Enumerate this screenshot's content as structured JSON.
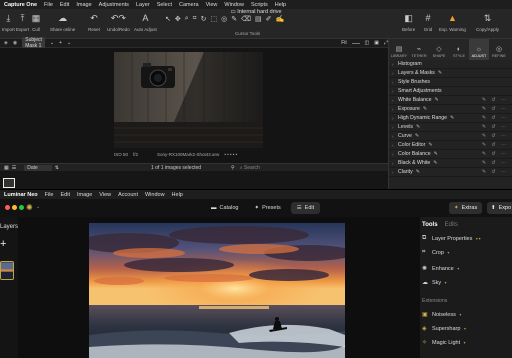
{
  "c1": {
    "menu": [
      "Capture One",
      "File",
      "Edit",
      "Image",
      "Adjustments",
      "Layer",
      "Select",
      "Camera",
      "View",
      "Window",
      "Scripts",
      "Help"
    ],
    "window_title": "Internal hard drive",
    "toolbar": {
      "import": "Import",
      "export": "Export",
      "cull": "Cull",
      "share": "Share online",
      "reset": "Reset",
      "undo_redo": "Undo/Redo",
      "auto_adjust": "Auto Adjust",
      "cursor_tools": "Cursor Tools",
      "before": "Before",
      "grid": "Grid",
      "exposure_warning": "Exp. Warning",
      "copy_apply": "Copy/Apply"
    },
    "subbar": {
      "subject_mask": "Subject Mask 1",
      "fit": "Fit"
    },
    "image_meta": {
      "iso": "ISO 50",
      "f": "f/2",
      "camera": "Sony-RX100Mark2-Shot43.arw",
      "rating": "• • • • •"
    },
    "bottombar": {
      "sort": "Date",
      "count": "1 of 1 images selected",
      "search_placeholder": "Search"
    },
    "tool_tabs": [
      "LIBRARY",
      "TETHER",
      "SHAPE",
      "STYLE",
      "ADJUST",
      "REFINE"
    ],
    "active_tab": "ADJUST",
    "panel_rows": [
      "Histogram",
      "Layers & Masks",
      "Style Brushes",
      "Smart Adjustments",
      "White Balance",
      "Exposure",
      "High Dynamic Range",
      "Levels",
      "Curve",
      "Color Editor",
      "Color Balance",
      "Black & White",
      "Clarity"
    ]
  },
  "ln": {
    "menu": [
      "Luminar Neo",
      "File",
      "Edit",
      "Image",
      "View",
      "Account",
      "Window",
      "Help"
    ],
    "nav": {
      "catalog": "Catalog",
      "presets": "Presets",
      "edit": "Edit"
    },
    "extras": "Extras",
    "export": "Expo",
    "layers": "Layers",
    "tabs": {
      "tools": "Tools",
      "edits": "Edits"
    },
    "tools": [
      "Layer Properties",
      "Crop",
      "Enhance",
      "Sky"
    ],
    "extensions_label": "Extensions",
    "extensions": [
      "Noiseless",
      "Supersharp",
      "Magic Light"
    ]
  },
  "colors": {
    "accent_gold": "#d4b14a",
    "warning": "#f0a030",
    "traffic_red": "#ff5f56",
    "traffic_yellow": "#ffbd2e",
    "traffic_green": "#27c93f"
  }
}
